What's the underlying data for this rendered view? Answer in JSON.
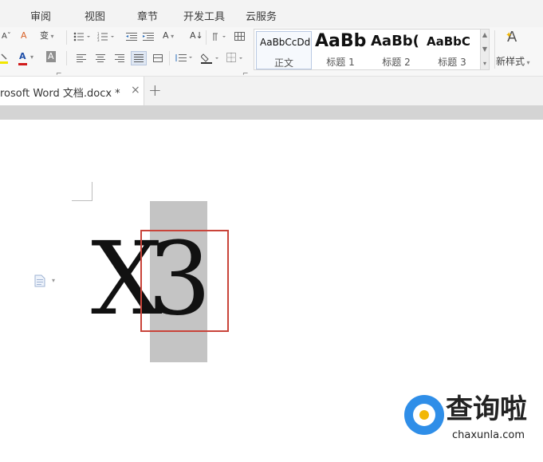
{
  "menu": {
    "tabs": [
      {
        "label": "审阅"
      },
      {
        "label": "视图"
      },
      {
        "label": "章节"
      },
      {
        "label": "开发工具"
      },
      {
        "label": "云服务"
      }
    ]
  },
  "ribbon": {
    "font_shrink_label": "A",
    "clear_format_label": "A",
    "phonetic_label": "变",
    "font_color_label": "A",
    "char_shading_label": "A",
    "grow_shrink_label": "A",
    "sort_label": "A↓",
    "styles": [
      {
        "sample": "AaBbCcDd",
        "name": "正文"
      },
      {
        "sample": "AaBb",
        "name": "标题 1"
      },
      {
        "sample": "AaBb(",
        "name": "标题 2"
      },
      {
        "sample": "AaBbC",
        "name": "标题 3"
      }
    ],
    "new_style_label": "新样式",
    "new_style_icon_text": "A",
    "colors": {
      "highlight": "#f2e600",
      "font_color": "#d11b1b"
    }
  },
  "document_tab": {
    "title": "rosoft Word 文档.docx *",
    "close_label": "×",
    "new_tab_label": "+"
  },
  "document": {
    "char_1": "X",
    "char_2": "3",
    "highlight_color": "#c4c4c4",
    "annotation_color": "#c9443a"
  },
  "watermark": {
    "title": "查询啦",
    "url": "chaxunla.com",
    "colors": {
      "ring": "#2f8ee8",
      "dot": "#f2b705"
    }
  }
}
